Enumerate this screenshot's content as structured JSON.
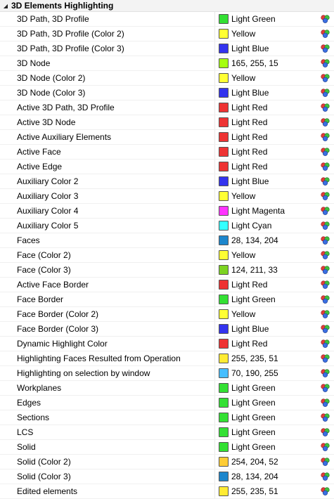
{
  "group": {
    "title": "3D Elements Highlighting",
    "expanded": true
  },
  "picker_icon": "color-picker-icon",
  "rows": [
    {
      "name": "3D Path, 3D Profile",
      "value": "Light Green",
      "color": "#33e033"
    },
    {
      "name": "3D Path, 3D Profile (Color 2)",
      "value": "Yellow",
      "color": "#ffff33"
    },
    {
      "name": "3D Path, 3D Profile (Color 3)",
      "value": "Light Blue",
      "color": "#3333ee"
    },
    {
      "name": "3D Node",
      "value": "165, 255, 15",
      "color": "#a5ff0f"
    },
    {
      "name": "3D Node (Color 2)",
      "value": "Yellow",
      "color": "#ffff33"
    },
    {
      "name": "3D Node (Color 3)",
      "value": "Light Blue",
      "color": "#3333ee"
    },
    {
      "name": "Active 3D Path, 3D Profile",
      "value": "Light Red",
      "color": "#ee3333"
    },
    {
      "name": "Active 3D Node",
      "value": "Light Red",
      "color": "#ee3333"
    },
    {
      "name": "Active Auxiliary Elements",
      "value": "Light Red",
      "color": "#ee3333"
    },
    {
      "name": "Active Face",
      "value": "Light Red",
      "color": "#ee3333"
    },
    {
      "name": "Active Edge",
      "value": "Light Red",
      "color": "#ee3333"
    },
    {
      "name": "Auxiliary Color 2",
      "value": "Light Blue",
      "color": "#3333ee"
    },
    {
      "name": "Auxiliary Color 3",
      "value": "Yellow",
      "color": "#ffff33"
    },
    {
      "name": "Auxiliary Color 4",
      "value": "Light Magenta",
      "color": "#ff33ff"
    },
    {
      "name": "Auxiliary Color 5",
      "value": "Light Cyan",
      "color": "#33ffff"
    },
    {
      "name": "Faces",
      "value": "28, 134, 204",
      "color": "#1c86cc"
    },
    {
      "name": "Face (Color 2)",
      "value": "Yellow",
      "color": "#ffff33"
    },
    {
      "name": "Face (Color 3)",
      "value": "124, 211, 33",
      "color": "#7cd321"
    },
    {
      "name": "Active Face Border",
      "value": "Light Red",
      "color": "#ee3333"
    },
    {
      "name": "Face Border",
      "value": "Light Green",
      "color": "#33e033"
    },
    {
      "name": "Face Border (Color 2)",
      "value": "Yellow",
      "color": "#ffff33"
    },
    {
      "name": "Face Border (Color 3)",
      "value": "Light Blue",
      "color": "#3333ee"
    },
    {
      "name": "Dynamic Highlight Color",
      "value": "Light Red",
      "color": "#ee3333"
    },
    {
      "name": "Highlighting Faces Resulted from Operation",
      "value": "255, 235, 51",
      "color": "#ffeb33"
    },
    {
      "name": "Highlighting on selection by window",
      "value": "70, 190, 255",
      "color": "#46beff"
    },
    {
      "name": "Workplanes",
      "value": "Light Green",
      "color": "#33e033"
    },
    {
      "name": "Edges",
      "value": "Light Green",
      "color": "#33e033"
    },
    {
      "name": "Sections",
      "value": "Light Green",
      "color": "#33e033"
    },
    {
      "name": "LCS",
      "value": "Light Green",
      "color": "#33e033"
    },
    {
      "name": "Solid",
      "value": "Light Green",
      "color": "#33e033"
    },
    {
      "name": "Solid (Color 2)",
      "value": "254, 204, 52",
      "color": "#fecc34"
    },
    {
      "name": "Solid (Color 3)",
      "value": "28, 134, 204",
      "color": "#1c86cc"
    },
    {
      "name": "Edited elements",
      "value": "255, 235, 51",
      "color": "#ffeb33"
    }
  ]
}
